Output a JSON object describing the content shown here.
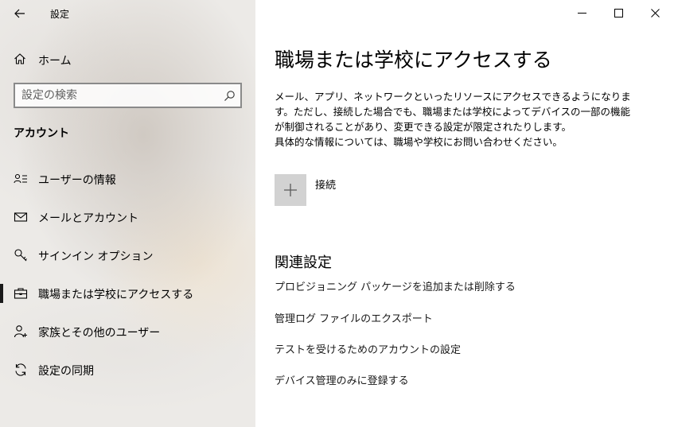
{
  "window": {
    "app_title": "設定"
  },
  "sidebar": {
    "home_label": "ホーム",
    "search_placeholder": "設定の検索",
    "section_title": "アカウント",
    "items": [
      {
        "label": "ユーザーの情報",
        "icon": "user-info-icon"
      },
      {
        "label": "メールとアカウント",
        "icon": "mail-icon"
      },
      {
        "label": "サインイン オプション",
        "icon": "key-icon"
      },
      {
        "label": "職場または学校にアクセスする",
        "icon": "briefcase-icon",
        "active": true
      },
      {
        "label": "家族とその他のユーザー",
        "icon": "family-icon"
      },
      {
        "label": "設定の同期",
        "icon": "sync-icon"
      }
    ]
  },
  "main": {
    "title": "職場または学校にアクセスする",
    "description": [
      "メール、アプリ、ネットワークといったリソースにアクセスできるようになります。ただし、接続した場合でも、職場または学校によってデバイスの一部の機能が制御されることがあり、変更できる設定が限定されたりします。",
      "具体的な情報については、職場や学校にお問い合わせください。"
    ],
    "connect_label": "接続",
    "related_title": "関連設定",
    "related_links": [
      "プロビジョニング パッケージを追加または削除する",
      "管理ログ ファイルのエクスポート",
      "テストを受けるためのアカウントの設定",
      "デバイス管理のみに登録する"
    ]
  },
  "colors": {
    "accent": "#1a1a1a",
    "connect_button_bg": "#d2d2d2"
  }
}
